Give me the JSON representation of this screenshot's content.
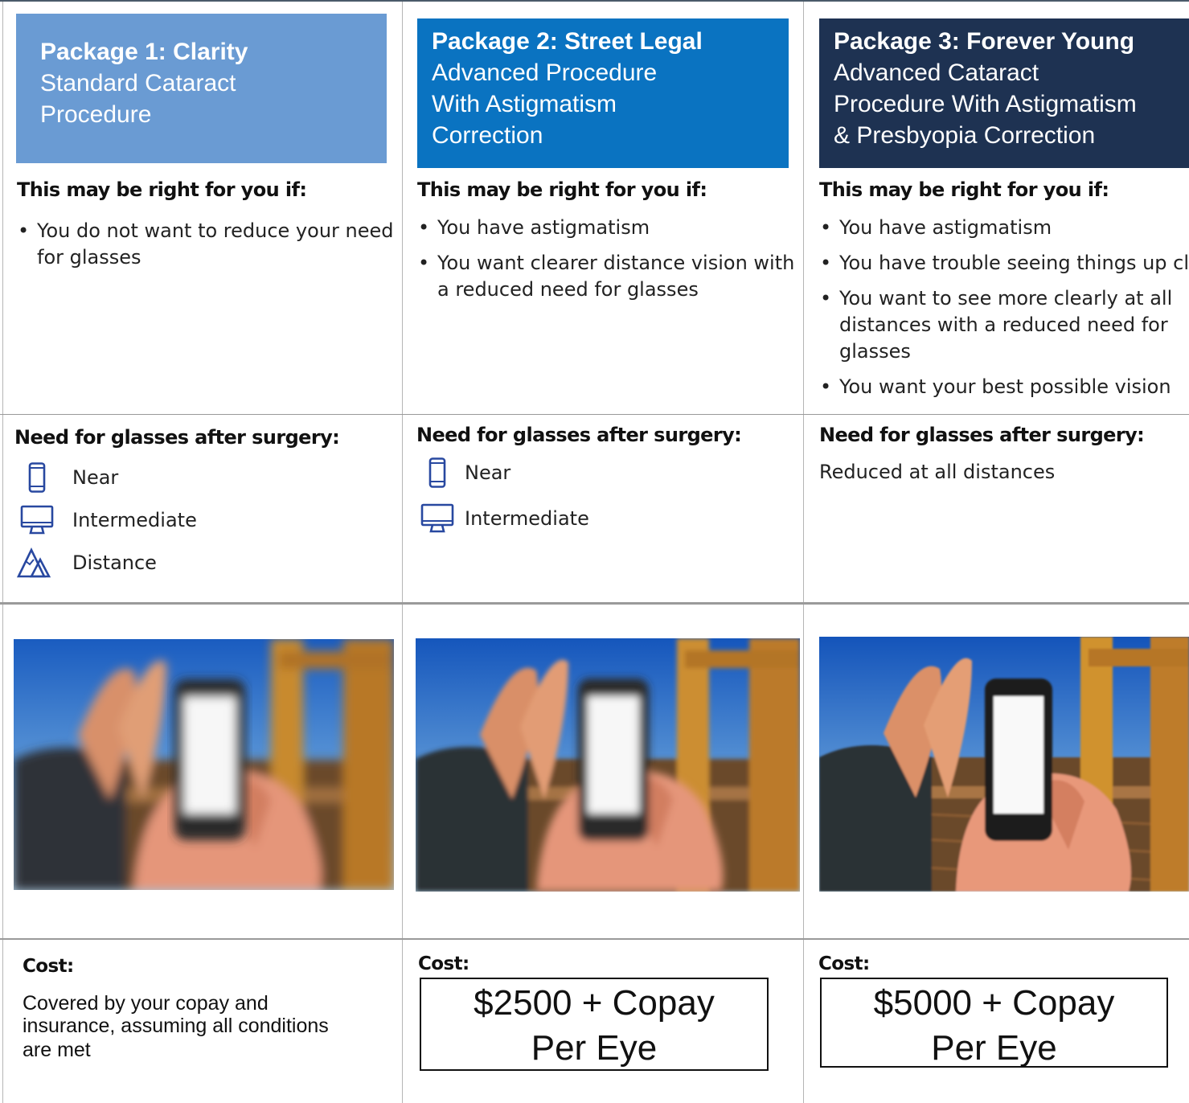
{
  "colors": {
    "pkg1_header": "#6a9bd3",
    "pkg2_header": "#0a73c1",
    "pkg3_header": "#1e3252",
    "icon_blue": "#2848a0"
  },
  "packages": [
    {
      "title": "Package 1: Clarity",
      "subtitle_lines": [
        "Standard Cataract",
        "Procedure"
      ],
      "right_for_you_heading": "This may be right for you if:",
      "bullets": [
        [
          "You do not want to reduce your need",
          "for glasses"
        ]
      ],
      "glasses_heading": "Need for glasses after surgery:",
      "glasses_needs": [
        {
          "icon": "phone-icon",
          "label": "Near"
        },
        {
          "icon": "monitor-icon",
          "label": "Intermediate"
        },
        {
          "icon": "mountain-icon",
          "label": "Distance"
        }
      ],
      "cost_label": "Cost:",
      "cost_text_lines": [
        "Covered by your copay and",
        "insurance, assuming all conditions",
        "are met"
      ]
    },
    {
      "title": "Package 2: Street Legal",
      "subtitle_lines": [
        "Advanced Procedure",
        "With Astigmatism",
        "Correction"
      ],
      "right_for_you_heading": "This may be right for you if:",
      "bullets": [
        [
          "You have astigmatism"
        ],
        [
          "You want clearer distance vision with",
          "a reduced need for glasses"
        ]
      ],
      "glasses_heading": "Need for glasses after surgery:",
      "glasses_needs": [
        {
          "icon": "phone-icon",
          "label": "Near"
        },
        {
          "icon": "monitor-icon",
          "label": "Intermediate"
        }
      ],
      "cost_label": "Cost:",
      "price_lines": [
        "$2500  + Copay",
        "Per Eye"
      ]
    },
    {
      "title": "Package 3: Forever Young",
      "subtitle_lines": [
        "Advanced Cataract",
        "Procedure With Astigmatism",
        "& Presbyopia Correction"
      ],
      "right_for_you_heading": "This may be right for you if:",
      "bullets": [
        [
          "You have astigmatism"
        ],
        [
          "You have trouble seeing things up clo"
        ],
        [
          "You want to see more clearly at all",
          "distances with a reduced need for",
          "glasses"
        ],
        [
          "You want your best possible vision"
        ]
      ],
      "glasses_heading": "Need for glasses after surgery:",
      "glasses_text": "Reduced at all distances",
      "cost_label": "Cost:",
      "price_lines": [
        "$5000 + Copay",
        "Per Eye"
      ]
    }
  ]
}
